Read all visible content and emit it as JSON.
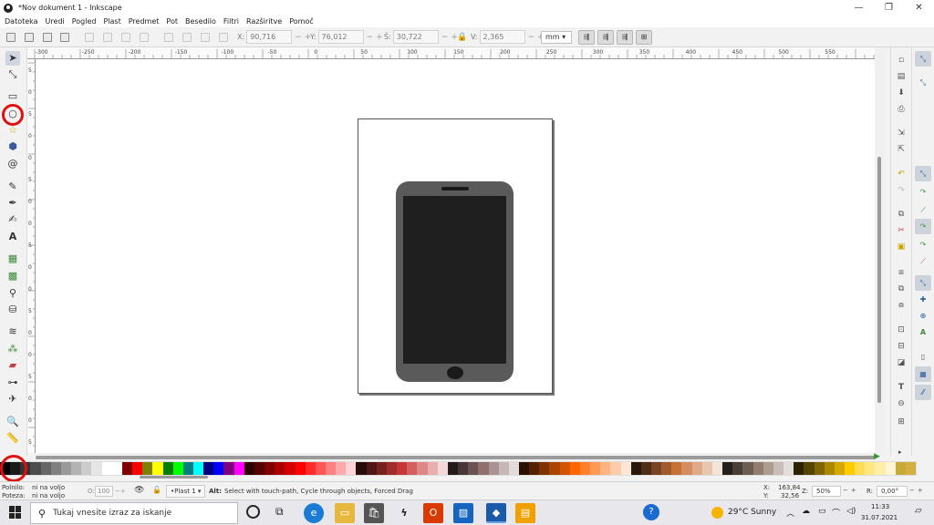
{
  "window": {
    "title": "*Nov dokument 1 - Inkscape",
    "controls": [
      "—",
      "❐",
      "✕"
    ]
  },
  "menu": [
    "Datoteka",
    "Uredi",
    "Pogled",
    "Plast",
    "Predmet",
    "Pot",
    "Besedilo",
    "Filtri",
    "Razširitve",
    "Pomoč"
  ],
  "toolbar": {
    "x": {
      "label": "X:",
      "value": "90,716"
    },
    "y": {
      "label": "Y:",
      "value": "76,012"
    },
    "w": {
      "label": "Š:",
      "value": "30,722"
    },
    "h": {
      "label": "V:",
      "value": "2,365"
    },
    "units": "mm ▾"
  },
  "ruler_labels": [
    "-300",
    "-250",
    "-200",
    "-150",
    "-100",
    "-50",
    "0",
    "50",
    "100",
    "150",
    "200",
    "250",
    "300",
    "350",
    "400",
    "450",
    "500",
    "550"
  ],
  "vruler_labels": [
    "5",
    "0",
    "5",
    "0",
    "0",
    "5",
    "0",
    "0",
    "5",
    "0",
    "0",
    "5",
    "0",
    "0",
    "5",
    "0",
    "0",
    "5"
  ],
  "tools": [
    "selector-tool",
    "node-tool",
    "rect-tool",
    "ellipse-tool",
    "star-tool",
    "3dbox-tool",
    "spiral-tool",
    "pencil-tool",
    "pen-tool",
    "calligraphy-tool",
    "text-tool",
    "gradient-tool",
    "mesh-tool",
    "dropper-tool",
    "paintbucket-tool",
    "tweak-tool",
    "spray-tool",
    "eraser-tool",
    "connector-tool",
    "zoom-tool",
    "measure-tool"
  ],
  "palette": {
    "colors": [
      "#000000",
      "#1a1a1a",
      "#333333",
      "#4d4d4d",
      "#666666",
      "#808080",
      "#999999",
      "#b3b3b3",
      "#cccccc",
      "#e6e6e6",
      "#ffffff",
      "#ffffff",
      "#800000",
      "#ff0000",
      "#808000",
      "#ffff00",
      "#008000",
      "#00ff00",
      "#008080",
      "#00ffff",
      "#000080",
      "#0000ff",
      "#800080",
      "#ff00ff",
      "#2b0000",
      "#550000",
      "#800000",
      "#aa0000",
      "#d40000",
      "#ff0000",
      "#ff2a2a",
      "#ff5555",
      "#ff8080",
      "#ffaaaa",
      "#ffd5d5",
      "#280b0b",
      "#501616",
      "#782121",
      "#a02c2c",
      "#c83737",
      "#d35f5f",
      "#de8787",
      "#e9afaf",
      "#f4d7d7",
      "#241c1c",
      "#483737",
      "#6c5353",
      "#916f6f",
      "#ac9393",
      "#c8b7b7",
      "#e3dbdb",
      "#2b1100",
      "#552200",
      "#803300",
      "#aa4400",
      "#d45500",
      "#ff6600",
      "#ff7f2a",
      "#ff9955",
      "#ffb380",
      "#ffccaa",
      "#ffe6d5",
      "#28170b",
      "#502d16",
      "#784421",
      "#a05a2c",
      "#c87137",
      "#d38d5f",
      "#deaa87",
      "#e9c6af",
      "#f4e3d7",
      "#241f1c",
      "#483e37",
      "#6c5d53",
      "#917c6f",
      "#ac9d93",
      "#c8beb7",
      "#e3dedb",
      "#2b2200",
      "#554400",
      "#806600",
      "#aa8800",
      "#d4aa00",
      "#ffcc00",
      "#ffdd55",
      "#ffe680",
      "#ffeeaa",
      "#fff6d5",
      "#c8ab37",
      "#d4b040"
    ]
  },
  "status": {
    "fill_label": "Polnilo:",
    "fill_value": "ni na voljo",
    "stroke_label": "Poteza:",
    "stroke_value": "ni na voljo",
    "opacity_label": "O:",
    "opacity_value": "100",
    "layer": "•Plast 1 ▾",
    "message_bold": "Alt:",
    "message": "Select with touch-path, Cycle through objects, Forced Drag",
    "x_label": "X:",
    "x_value": "163,84",
    "y_label": "Y:",
    "y_value": "32,56",
    "zoom_label": "Z:",
    "zoom_value": "50%",
    "rot_label": "R:",
    "rot_value": "0,00°"
  },
  "taskbar": {
    "search_placeholder": "Tukaj vnesite izraz za iskanje",
    "weather": "29°C  Sunny",
    "time": "11:33",
    "date": "31.07.2021"
  },
  "colors": {
    "phone_body": "#5a5a5a",
    "phone_screen": "#1f1f1f",
    "annotation": "#e01010"
  }
}
